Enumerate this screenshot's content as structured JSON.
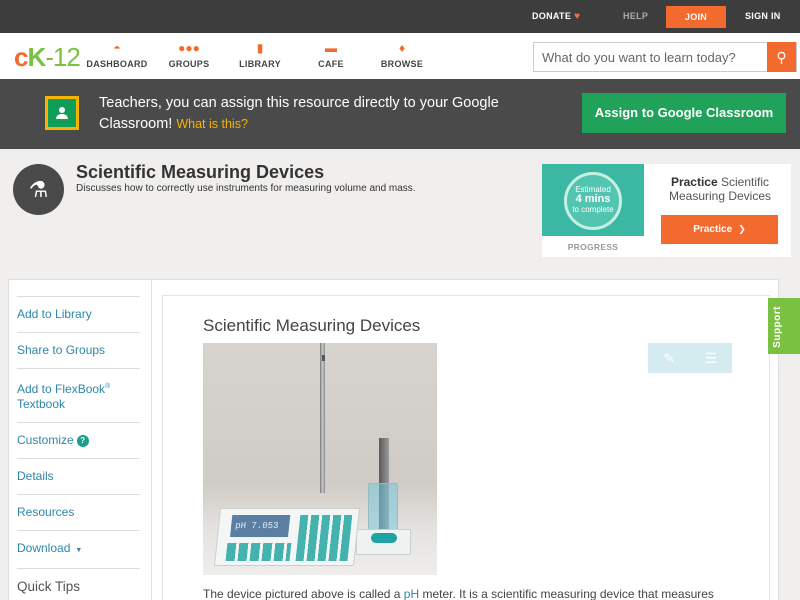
{
  "topbar": {
    "donate": "DONATE",
    "help": "HELP",
    "join": "JOIN",
    "signin": "SIGN IN"
  },
  "nav": {
    "logo_c": "c",
    "logo_k": "K",
    "logo_num": "-12",
    "items": [
      {
        "label": "DASHBOARD",
        "icon": "dashboard-icon"
      },
      {
        "label": "GROUPS",
        "icon": "groups-icon"
      },
      {
        "label": "LIBRARY",
        "icon": "library-icon"
      },
      {
        "label": "CAFE",
        "icon": "chat-bubbles-icon"
      },
      {
        "label": "BROWSE",
        "icon": "lightbulb-icon"
      }
    ],
    "search_placeholder": "What do you want to learn today?"
  },
  "banner": {
    "text": "Teachers, you can assign this resource directly to your Google Classroom!",
    "link": "What is this?",
    "button": "Assign to Google Classroom"
  },
  "header": {
    "title": "Scientific Measuring Devices",
    "subtitle": "Discusses how to correctly use instruments for measuring volume and mass."
  },
  "practice": {
    "estimated": "Estimated",
    "mins": "4 mins",
    "complete": "to complete",
    "progress_label": "PROGRESS",
    "title_bold": "Practice",
    "title_rest": "Scientific Measuring Devices",
    "button": "Practice"
  },
  "sidebar": {
    "add_library": "Add to Library",
    "share_groups": "Share to Groups",
    "add_flexbook": "Add to FlexBook",
    "reg": "®",
    "textbook": "Textbook",
    "customize": "Customize",
    "details": "Details",
    "resources": "Resources",
    "download": "Download",
    "quick_tips": "Quick Tips"
  },
  "article": {
    "title": "Scientific Measuring Devices",
    "meter_display": "pH   7.053",
    "para_start": "The device pictured above is called a ",
    "para_link": "pH",
    "para_end": " meter. It is a scientific measuring device that measures"
  },
  "support": "Support",
  "colors": {
    "accent": "#f36a2f",
    "brand_green": "#7ac142",
    "classroom_green": "#20a25a",
    "link_blue": "#2e86a8",
    "banner_bg": "#4b4a4a"
  }
}
